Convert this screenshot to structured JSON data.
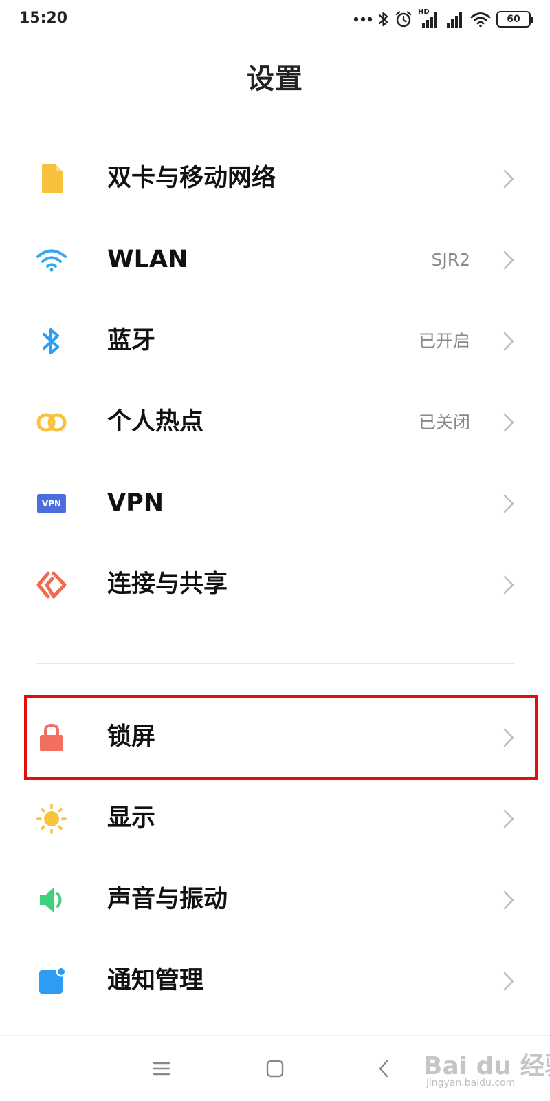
{
  "status_bar": {
    "time": "15:20",
    "battery": "60",
    "icons": [
      "more-dots-icon",
      "bluetooth-icon",
      "alarm-icon",
      "hd-signal-icon",
      "signal-icon",
      "wifi-icon",
      "battery-icon"
    ],
    "hd_label": "HD"
  },
  "header": {
    "title": "设置"
  },
  "settings": {
    "items": [
      {
        "label": "双卡与移动网络",
        "value": "",
        "icon": "sim-card-icon"
      },
      {
        "label": "WLAN",
        "value": "SJR2",
        "icon": "wifi-icon"
      },
      {
        "label": "蓝牙",
        "value": "已开启",
        "icon": "bluetooth-icon"
      },
      {
        "label": "个人热点",
        "value": "已关闭",
        "icon": "hotspot-icon"
      },
      {
        "label": "VPN",
        "value": "",
        "icon": "vpn-icon",
        "icon_text": "VPN"
      },
      {
        "label": "连接与共享",
        "value": "",
        "icon": "connection-share-icon"
      },
      {
        "label": "锁屏",
        "value": "",
        "icon": "lock-icon"
      },
      {
        "label": "显示",
        "value": "",
        "icon": "sun-icon"
      },
      {
        "label": "声音与振动",
        "value": "",
        "icon": "speaker-icon"
      },
      {
        "label": "通知管理",
        "value": "",
        "icon": "notification-icon"
      }
    ]
  },
  "colors": {
    "sim": "#f8c13c",
    "wifi": "#3aa8f0",
    "bluetooth": "#2d9ef0",
    "hotspot": "#f5c242",
    "vpn": "#4a6ee0",
    "connection": "#f26b4f",
    "lock": "#f26e5e",
    "sun": "#f7c53c",
    "speaker": "#3ed07a",
    "notification": "#2e9cf2",
    "highlight": "#e01010"
  },
  "nav_bar": {
    "buttons": [
      "menu-icon",
      "home-icon",
      "back-icon"
    ]
  },
  "watermark": {
    "main": "Bai du 经验",
    "sub": "jingyan.baidu.com"
  }
}
